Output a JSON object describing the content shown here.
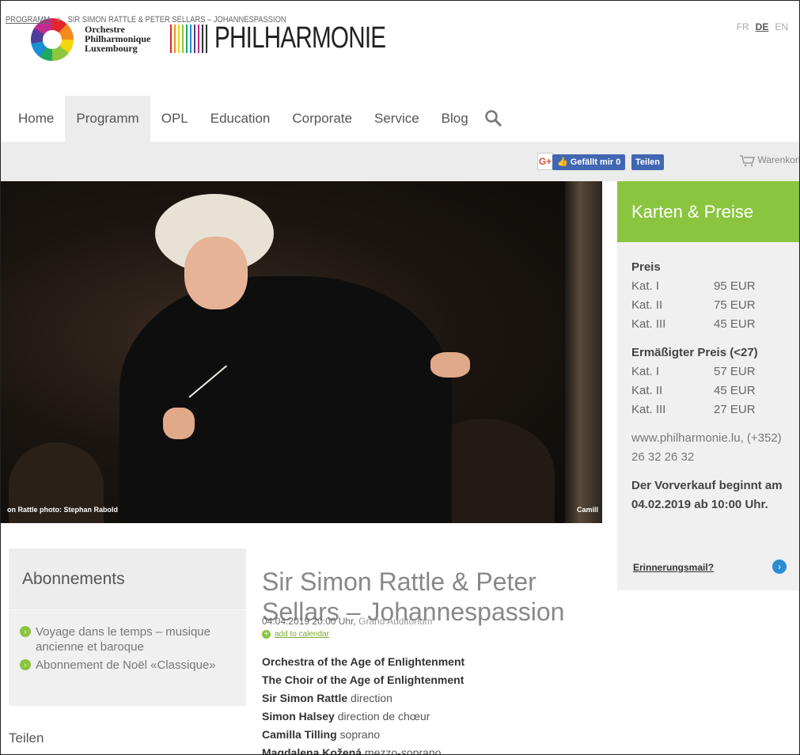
{
  "header": {
    "logo_text": [
      "Orchestre",
      "Philharmonique",
      "Luxembourg"
    ],
    "brand_word": "PHILHARMONIE",
    "languages": [
      "FR",
      "DE",
      "EN"
    ],
    "active_language": "DE"
  },
  "nav": {
    "items": [
      "Home",
      "Programm",
      "OPL",
      "Education",
      "Corporate",
      "Service",
      "Blog"
    ],
    "active": "Programm",
    "search_icon": "search-icon"
  },
  "breadcrumb": {
    "first": "PROGRAMM",
    "separator": ">",
    "current": "SIR SIMON RATTLE & PETER SELLARS – JOHANNESPASSION"
  },
  "social": {
    "gplus": "G+",
    "like_label": "Gefällt mir 0",
    "share_label": "Teilen"
  },
  "cart": {
    "label": "Warenkorb"
  },
  "hero": {
    "caption_left": "on Rattle photo: Stephan Rabold",
    "caption_right": "Camill"
  },
  "tickets": {
    "heading": "Karten & Preise",
    "price_label": "Preis",
    "prices": [
      {
        "cat": "Kat. I",
        "price": "95 EUR"
      },
      {
        "cat": "Kat. II",
        "price": "75 EUR"
      },
      {
        "cat": "Kat. III",
        "price": "45 EUR"
      }
    ],
    "reduced_label": "Ermäßigter Preis (<27)",
    "reduced_prices": [
      {
        "cat": "Kat. I",
        "price": "57 EUR"
      },
      {
        "cat": "Kat. II",
        "price": "45 EUR"
      },
      {
        "cat": "Kat. III",
        "price": "27 EUR"
      }
    ],
    "contact": "www.philharmonie.lu, (+352) 26 32 26 32",
    "presale": "Der Vorverkauf beginnt am 04.02.2019 ab 10:00 Uhr.",
    "reminder": "Erinnerungsmail?",
    "reminder_icon": "›"
  },
  "abonnements": {
    "heading": "Abonnements",
    "items": [
      "Voyage dans le temps – musique ancienne et baroque",
      "Abonnement de Noël «Classique»"
    ],
    "bullet": "›"
  },
  "share": {
    "label": "Teilen"
  },
  "event": {
    "title": "Sir Simon Rattle & Peter Sellars – Johannespassion",
    "datetime": "04.04.2019 20:00 Uhr,",
    "venue": "Grand Auditorium",
    "calendar_link": "add to calendar",
    "calendar_icon": "+",
    "performers": [
      {
        "name": "Orchestra of the Age of Enlightenment",
        "role": ""
      },
      {
        "name": "The Choir of the Age of Enlightenment",
        "role": ""
      },
      {
        "name": "Sir Simon Rattle",
        "role": "direction"
      },
      {
        "name": "Simon Halsey",
        "role": "direction de chœur"
      },
      {
        "name": "Camilla Tilling",
        "role": "soprano"
      },
      {
        "name": "Magdalena Kožená",
        "role": "mezzo-soprano"
      }
    ]
  },
  "colors": {
    "green": "#8bc53f",
    "blue": "#2a8dd4",
    "facebook": "#4267b2",
    "nav_active_bg": "#ececec"
  }
}
